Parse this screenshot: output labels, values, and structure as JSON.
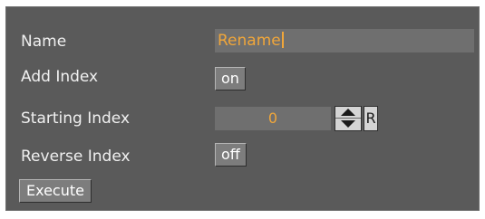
{
  "fields": {
    "name_label": "Name",
    "name_value": "Rename",
    "add_index_label": "Add Index",
    "add_index_value": "on",
    "starting_index_label": "Starting Index",
    "starting_index_value": "0",
    "reset_label": "R",
    "reverse_index_label": "Reverse Index",
    "reverse_index_value": "off"
  },
  "actions": {
    "execute_label": "Execute"
  },
  "icons": {
    "stepper_up": "triangle-up-icon",
    "stepper_down": "triangle-down-icon"
  },
  "colors": {
    "panel_bg": "#5a5a5a",
    "field_bg": "#6f6f6f",
    "value_text": "#f0a63a",
    "label_text": "#f0f0f0"
  }
}
